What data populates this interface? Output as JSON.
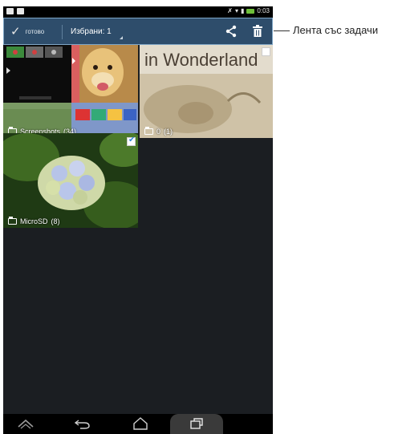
{
  "status_bar": {
    "time": "0:03"
  },
  "action_bar": {
    "done_label": "готово",
    "selected_label": "Избрани: 1"
  },
  "callout": {
    "label": "Лента със задачи"
  },
  "gallery": {
    "albums": [
      {
        "name": "Screenshots",
        "count": "(34)"
      },
      {
        "name": "0",
        "count": "(1)",
        "preview_text": "in Wonderland"
      },
      {
        "name": "MicroSD",
        "count": "(8)",
        "selected": true
      }
    ]
  },
  "icons": {
    "done": "check-icon",
    "share": "share-icon",
    "delete": "trash-icon",
    "nav": [
      "up-icon",
      "back-icon",
      "home-icon",
      "recent-apps-icon"
    ]
  },
  "colors": {
    "action_bar": "#2e4d6b",
    "checkbox_check": "#2f86d6",
    "battery": "#6fbf3a"
  }
}
